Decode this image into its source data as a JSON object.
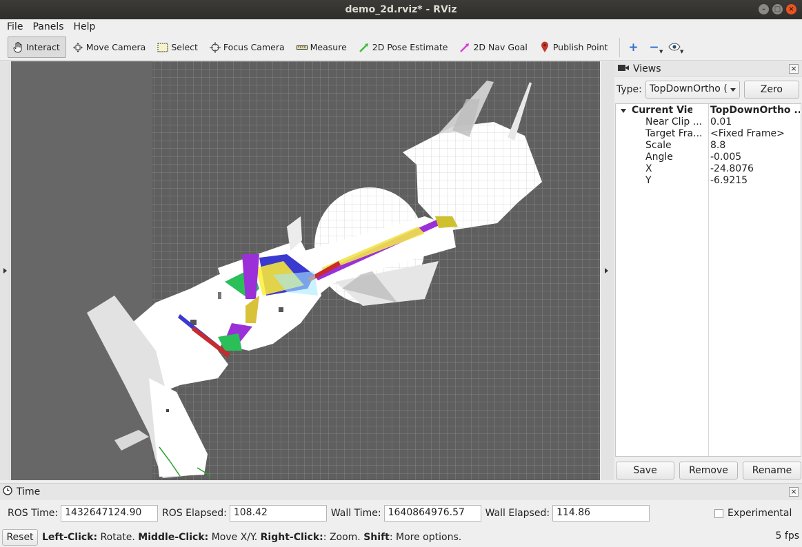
{
  "window": {
    "title": "demo_2d.rviz* - RViz"
  },
  "menu": [
    "File",
    "Panels",
    "Help"
  ],
  "toolbar": {
    "tools": [
      {
        "label": "Interact",
        "icon": "hand-icon",
        "active": true
      },
      {
        "label": "Move Camera",
        "icon": "move-camera-icon"
      },
      {
        "label": "Select",
        "icon": "select-icon"
      },
      {
        "label": "Focus Camera",
        "icon": "focus-camera-icon"
      },
      {
        "label": "Measure",
        "icon": "measure-icon"
      },
      {
        "label": "2D Pose Estimate",
        "icon": "pose-estimate-arrow-icon",
        "color": "#39c239"
      },
      {
        "label": "2D Nav Goal",
        "icon": "nav-goal-arrow-icon",
        "color": "#d93fd9"
      },
      {
        "label": "Publish Point",
        "icon": "map-pin-icon",
        "color": "#c0392b"
      }
    ]
  },
  "views": {
    "title": "Views",
    "type_label": "Type:",
    "type_value": "TopDownOrtho (",
    "zero_label": "Zero",
    "tree": {
      "header": {
        "key": "Current View",
        "value": "TopDownOrtho ..."
      },
      "rows": [
        {
          "key": "Near Clip ...",
          "value": "0.01"
        },
        {
          "key": "Target Fra...",
          "value": "<Fixed Frame>"
        },
        {
          "key": "Scale",
          "value": "8.8"
        },
        {
          "key": "Angle",
          "value": "-0.005"
        },
        {
          "key": "X",
          "value": "-24.8076"
        },
        {
          "key": "Y",
          "value": "-6.9215"
        }
      ]
    },
    "buttons": {
      "save": "Save",
      "remove": "Remove",
      "rename": "Rename"
    }
  },
  "time": {
    "title": "Time",
    "ros_time_label": "ROS Time:",
    "ros_time": "1432647124.90",
    "ros_elapsed_label": "ROS Elapsed:",
    "ros_elapsed": "108.42",
    "wall_time_label": "Wall Time:",
    "wall_time": "1640864976.57",
    "wall_elapsed_label": "Wall Elapsed:",
    "wall_elapsed": "114.86",
    "experimental_label": "Experimental"
  },
  "status": {
    "reset_label": "Reset",
    "hint_left_key": "Left-Click:",
    "hint_left": " Rotate. ",
    "hint_middle_key": "Middle-Click:",
    "hint_middle": " Move X/Y. ",
    "hint_right_key": "Right-Click:",
    "hint_right": ": Zoom. ",
    "hint_shift_key": "Shift",
    "hint_shift": ": More options.",
    "fps": "5 fps"
  },
  "colors": {
    "viewport_bg": "#676767",
    "grid_bg": "#5e5e5e",
    "grid_line": "#8a8a8a",
    "map_free": "#ffffff"
  }
}
